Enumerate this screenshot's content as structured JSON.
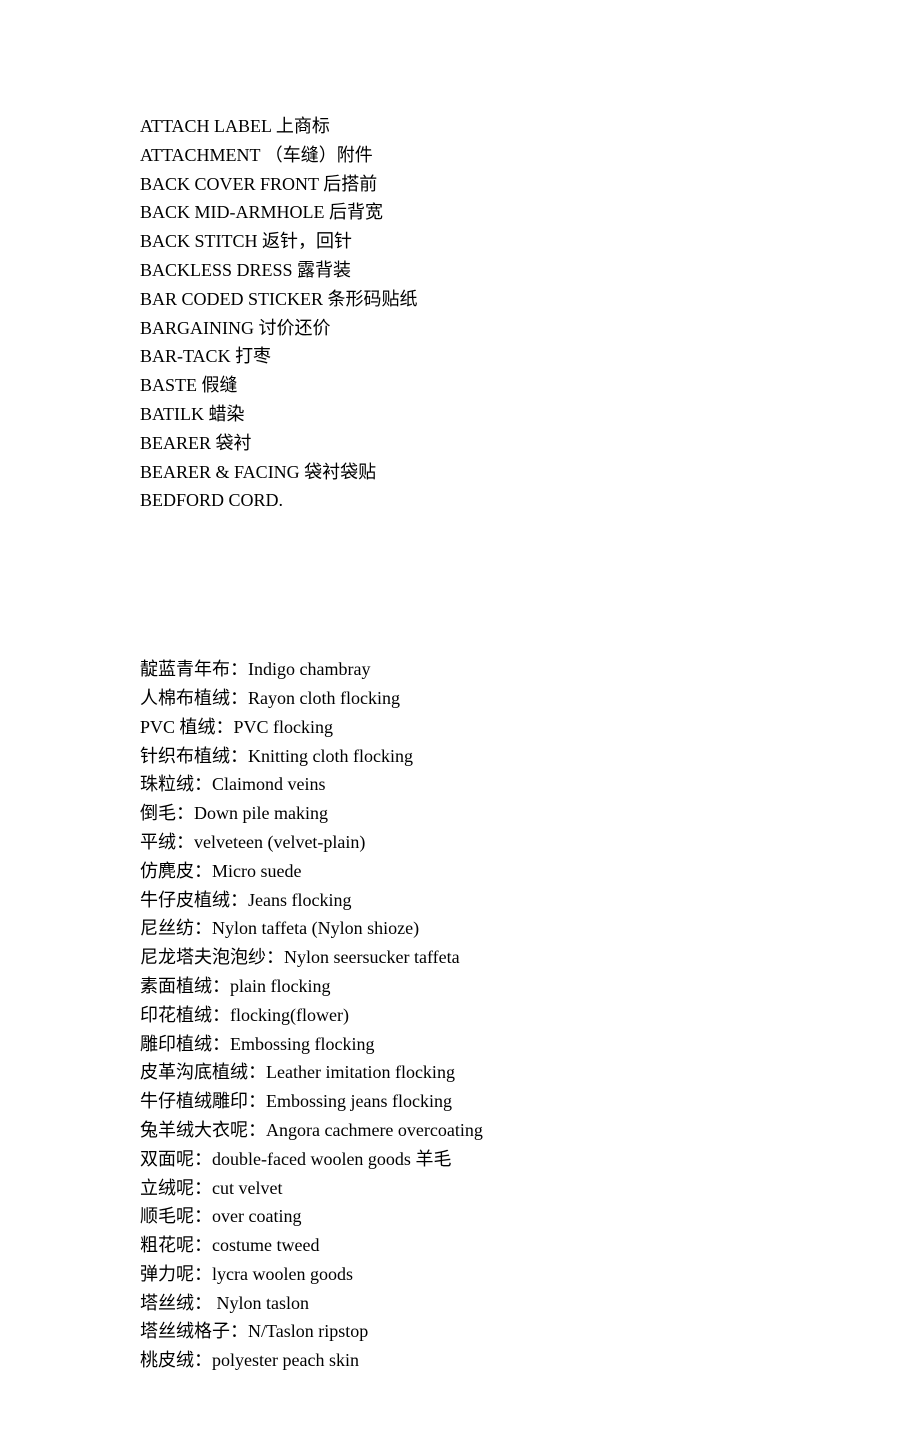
{
  "section1": [
    "ATTACH LABEL 上商标",
    "ATTACHMENT （车缝）附件",
    "BACK COVER FRONT 后搭前",
    "BACK MID-ARMHOLE 后背宽",
    "BACK STITCH 返针，回针",
    "BACKLESS DRESS 露背装",
    "BAR CODED STICKER 条形码贴纸",
    "BARGAINING 讨价还价",
    "BAR-TACK 打枣",
    "BASTE 假缝",
    "BATILK 蜡染",
    "BEARER 袋衬",
    "BEARER & FACING 袋衬袋贴",
    "BEDFORD CORD."
  ],
  "section2": [
    "靛蓝青年布：Indigo chambray",
    "人棉布植绒：Rayon cloth flocking",
    "PVC 植绒：PVC flocking",
    "针织布植绒：Knitting cloth flocking",
    "珠粒绒：Claimond veins",
    "倒毛：Down pile making",
    "平绒：velveteen (velvet-plain)",
    "仿麂皮：Micro suede",
    "牛仔皮植绒：Jeans flocking",
    "尼丝纺：Nylon taffeta (Nylon shioze)",
    "尼龙塔夫泡泡纱：Nylon seersucker taffeta",
    "素面植绒：plain flocking",
    "印花植绒：flocking(flower)",
    "雕印植绒：Embossing flocking",
    "皮革沟底植绒：Leather imitation flocking",
    "牛仔植绒雕印：Embossing jeans flocking",
    "兔羊绒大衣呢：Angora cachmere overcoating",
    "双面呢：double-faced woolen goods 羊毛",
    "立绒呢：cut velvet",
    "顺毛呢：over coating",
    "粗花呢：costume tweed",
    "弹力呢：lycra woolen goods",
    "塔丝绒： Nylon taslon",
    "塔丝绒格子：N/Taslon ripstop",
    "桃皮绒：polyester peach skin"
  ]
}
